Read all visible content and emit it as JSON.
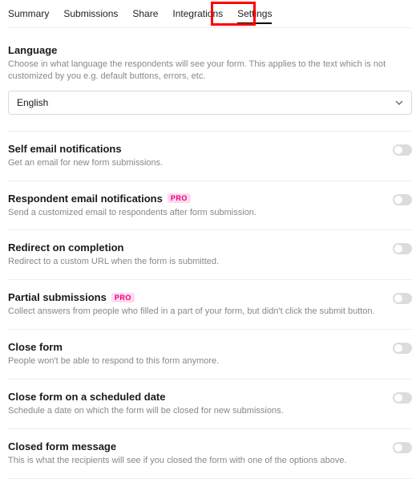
{
  "tabs": {
    "summary": "Summary",
    "submissions": "Submissions",
    "share": "Share",
    "integrations": "Integrations",
    "settings": "Settings"
  },
  "pro_label": "PRO",
  "language": {
    "title": "Language",
    "desc": "Choose in what language the respondents will see your form. This applies to the text which is not customized by you e.g. default buttons, errors, etc.",
    "value": "English"
  },
  "settings": {
    "self_email": {
      "title": "Self email notifications",
      "desc": "Get an email for new form submissions."
    },
    "respondent_email": {
      "title": "Respondent email notifications",
      "desc": "Send a customized email to respondents after form submission."
    },
    "redirect": {
      "title": "Redirect on completion",
      "desc": "Redirect to a custom URL when the form is submitted."
    },
    "partial": {
      "title": "Partial submissions",
      "desc": "Collect answers from people who filled in a part of your form, but didn't click the submit button."
    },
    "close_form": {
      "title": "Close form",
      "desc": "People won't be able to respond to this form anymore."
    },
    "close_scheduled": {
      "title": "Close form on a scheduled date",
      "desc": "Schedule a date on which the form will be closed for new submissions."
    },
    "closed_message": {
      "title": "Closed form message",
      "desc": "This is what the recipients will see if you closed the form with one of the options above."
    }
  }
}
